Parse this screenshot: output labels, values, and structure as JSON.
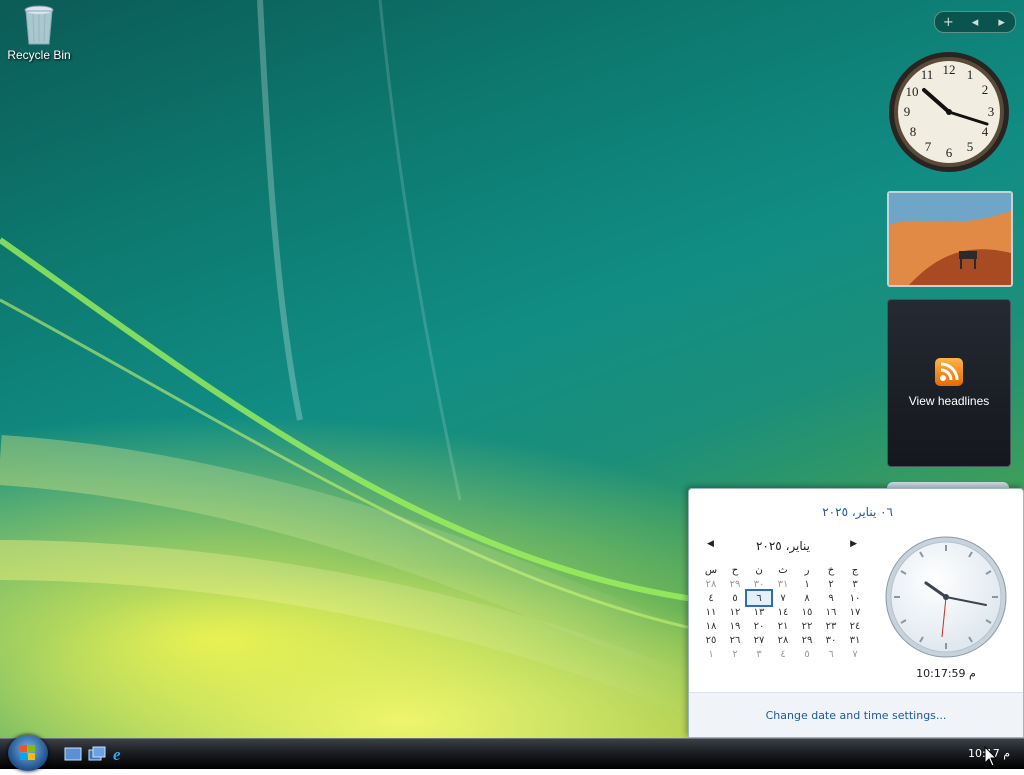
{
  "desktop": {
    "icons": [
      {
        "label": "Recycle Bin",
        "icon": "recycle-bin-icon"
      }
    ]
  },
  "sidebar": {
    "controls": {
      "add": "+",
      "prev": "◂",
      "next": "▸"
    },
    "feed_label": "View headlines"
  },
  "calendar_popup": {
    "full_date": "٠٦ يناير، ٢٠٢٥",
    "month_label": "يناير، ٢٠٢٥",
    "weekdays": [
      "ج",
      "خ",
      "ر",
      "ث",
      "ن",
      "ح",
      "س"
    ],
    "weeks": [
      [
        "٣",
        "٢",
        "١",
        "٣١",
        "٣٠",
        "٢٩",
        "٢٨"
      ],
      [
        "١٠",
        "٩",
        "٨",
        "٧",
        "٦",
        "٥",
        "٤"
      ],
      [
        "١٧",
        "١٦",
        "١٥",
        "١٤",
        "١٣",
        "١٢",
        "١١"
      ],
      [
        "٢٤",
        "٢٣",
        "٢٢",
        "٢١",
        "٢٠",
        "١٩",
        "١٨"
      ],
      [
        "٣١",
        "٣٠",
        "٢٩",
        "٢٨",
        "٢٧",
        "٢٦",
        "٢٥"
      ],
      [
        "٧",
        "٦",
        "٥",
        "٤",
        "٣",
        "٢",
        "١"
      ]
    ],
    "time": "10:17:59 م",
    "settings_link": "Change date and time settings..."
  },
  "taskbar": {
    "clock": "10:17 م"
  },
  "colors": {
    "link": "#1e5aa8",
    "accent": "#2a6fb8"
  }
}
